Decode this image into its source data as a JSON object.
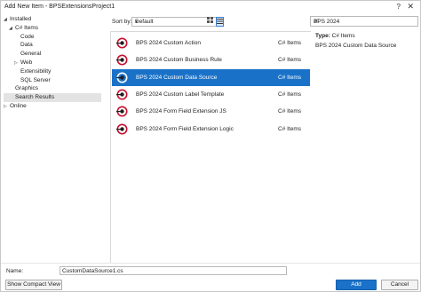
{
  "window": {
    "title": "Add New Item - BPSExtensionsProject1",
    "help_glyph": "?",
    "close_glyph": "✕"
  },
  "tree": {
    "items": [
      {
        "label": "Installed",
        "arrow": "◢",
        "level": 0
      },
      {
        "label": "C# Items",
        "arrow": "◢",
        "level": 1
      },
      {
        "label": "Code",
        "arrow": "",
        "level": 2
      },
      {
        "label": "Data",
        "arrow": "",
        "level": 2
      },
      {
        "label": "General",
        "arrow": "",
        "level": 2
      },
      {
        "label": "Web",
        "arrow": "▷",
        "level": 2
      },
      {
        "label": "Extensibility",
        "arrow": "",
        "level": 2
      },
      {
        "label": "SQL Server",
        "arrow": "",
        "level": 2
      },
      {
        "label": "Graphics",
        "arrow": "",
        "level": 1
      },
      {
        "label": "Search Results",
        "arrow": "",
        "level": 1,
        "selected": true
      },
      {
        "label": "Online",
        "arrow": "▷",
        "level": 0
      }
    ]
  },
  "sort": {
    "label": "Sort by:",
    "value": "Default",
    "dropdown_glyph": "▾",
    "grid_icon": "grid-view-icon",
    "list_icon": "list-view-icon"
  },
  "search": {
    "value": "BPS 2024",
    "clear_glyph": "✕"
  },
  "templates": [
    {
      "name": "BPS 2024 Custom Action",
      "type": "C# Items"
    },
    {
      "name": "BPS 2024 Custom Business Rule",
      "type": "C# Items"
    },
    {
      "name": "BPS 2024 Custom Data Source",
      "type": "C# Items",
      "selected": true
    },
    {
      "name": "BPS 2024 Custom Label Template",
      "type": "C# Items"
    },
    {
      "name": "BPS 2024 Form Field Extension JS",
      "type": "C# Items"
    },
    {
      "name": "BPS 2024 Form Field Extension Logic",
      "type": "C# Items"
    }
  ],
  "details": {
    "type_label": "Type:",
    "type_value": "C# Items",
    "description": "BPS 2024 Custom Data Source"
  },
  "footer": {
    "name_label": "Name:",
    "name_value": "CustomDataSource1.cs",
    "compact_button": "Show Compact View",
    "add_button": "Add",
    "cancel_button": "Cancel"
  },
  "colors": {
    "accent": "#1a72c8",
    "icon_red": "#c8102e"
  }
}
